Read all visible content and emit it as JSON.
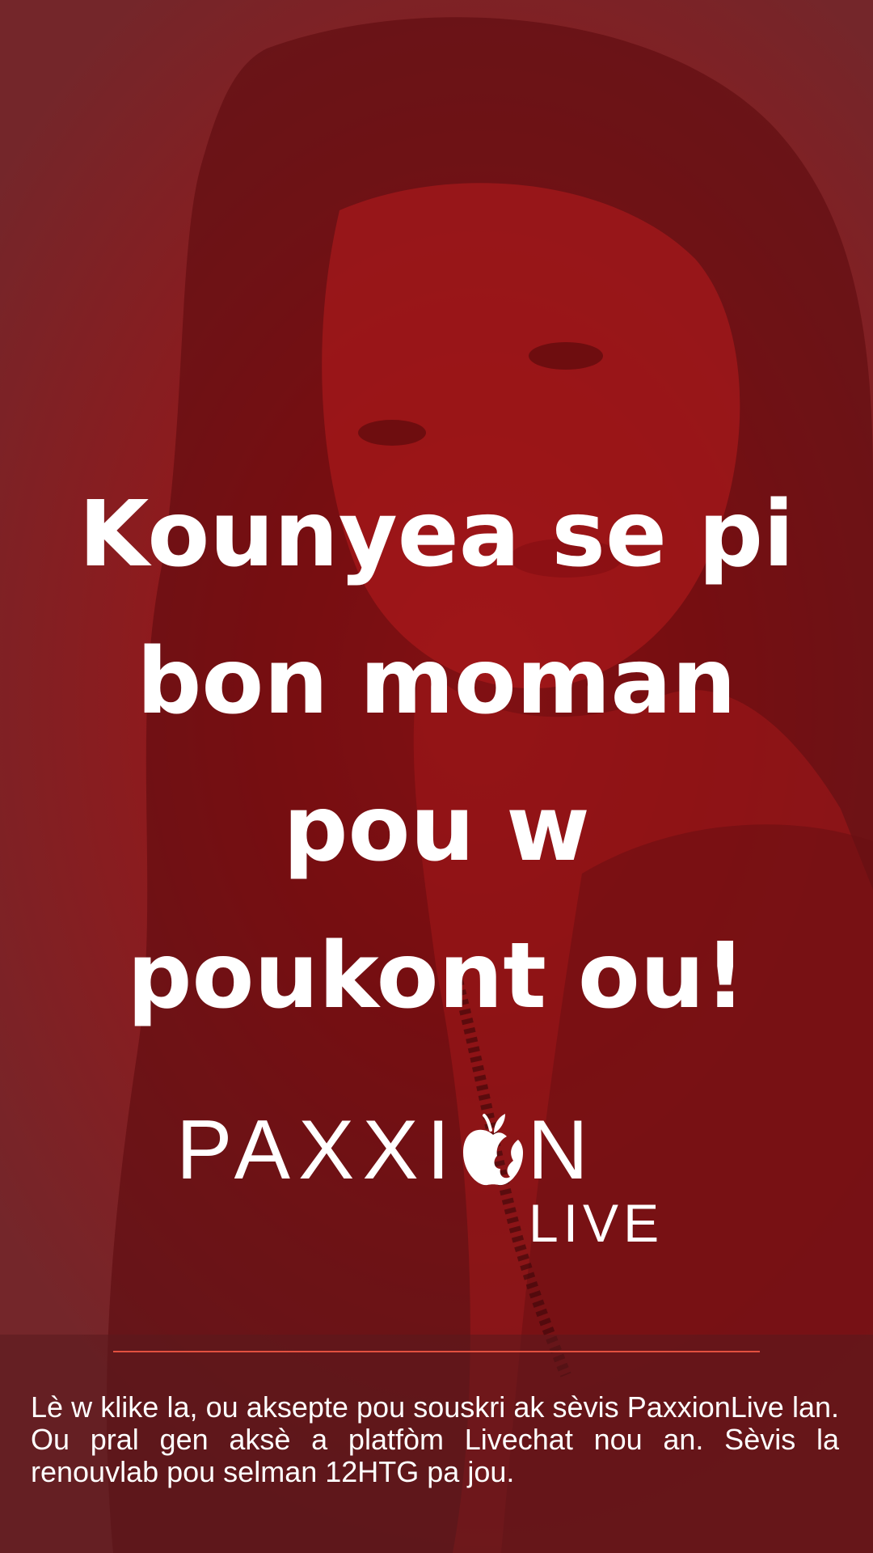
{
  "headline": {
    "lines": [
      "Kounyea se pi",
      "bon moman",
      "pou w",
      "poukont ou!"
    ]
  },
  "logo": {
    "word": "PAXXI",
    "word_end": "N",
    "sub": "LIVE",
    "icon": "apple-icon"
  },
  "footer": {
    "text": "Lè w klike la, ou aksepte pou souskri ak sèvis PaxxionLive lan. Ou pral gen aksè a platfòm Livechat nou an. Sèvis la renouvlab pou selman 12HTG pa jou."
  },
  "colors": {
    "background": "#9a1517",
    "accent_rule": "#e2503f",
    "text": "#ffffff"
  }
}
